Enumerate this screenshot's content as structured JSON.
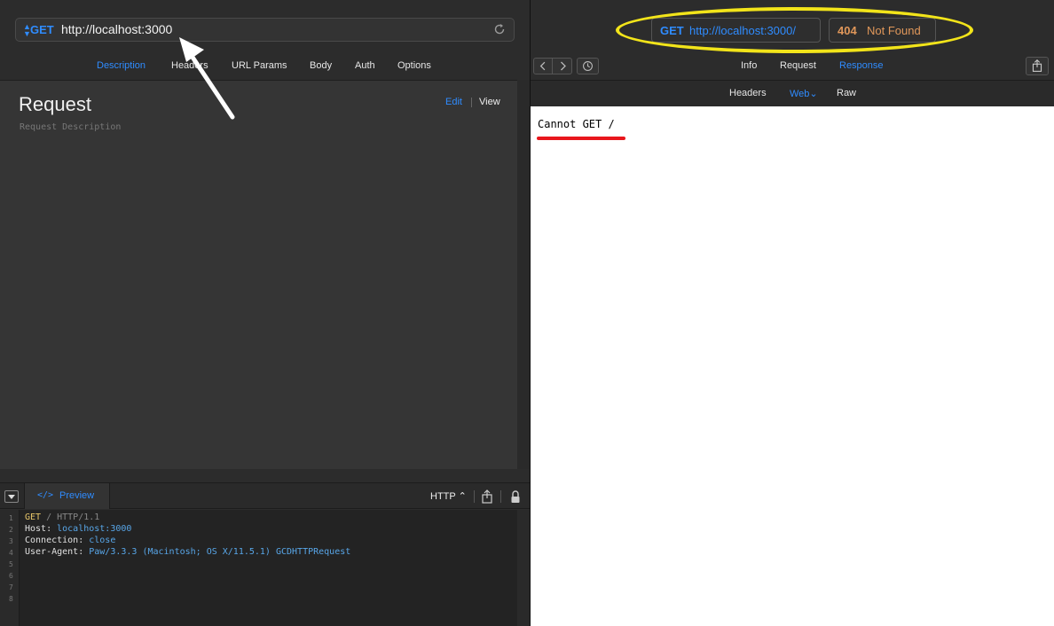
{
  "request": {
    "method": "GET",
    "url": "http://localhost:3000",
    "tabs": [
      "Description",
      "Headers",
      "URL Params",
      "Body",
      "Auth",
      "Options"
    ],
    "active_tab": "Description"
  },
  "description": {
    "title": "Request",
    "placeholder": "Request Description",
    "edit_label": "Edit",
    "view_label": "View"
  },
  "preview": {
    "tab_label": "Preview",
    "code_icon": "</>",
    "format_label": "HTTP ⌃",
    "line_numbers": [
      "1",
      "2",
      "3",
      "4",
      "5",
      "6",
      "7",
      "8"
    ],
    "lines": {
      "l1": {
        "method": "GET",
        "path": " / ",
        "version": "HTTP/1.1"
      },
      "l2": {
        "key": "Host: ",
        "value": "localhost:3000"
      },
      "l3": {
        "key": "Connection: ",
        "value": "close"
      },
      "l4": {
        "key": "User-Agent: ",
        "value": "Paw/3.3.3 (Macintosh; OS X/11.5.1) GCDHTTPRequest"
      }
    }
  },
  "response": {
    "method": "GET",
    "url": "http://localhost:3000/",
    "status_code": "404",
    "status_text": "Not Found",
    "tabs": [
      "Info",
      "Request",
      "Response"
    ],
    "active_tab": "Response",
    "sub_tabs": [
      "Headers",
      "Web",
      "Raw"
    ],
    "active_sub_tab": "Web",
    "web_dropdown": "Web⌄",
    "body_text": "Cannot GET /"
  },
  "colors": {
    "accent": "#2f8cff",
    "status": "#e0975a",
    "highlight_ellipse": "#f2e41a",
    "underline": "#e8161c"
  },
  "icons": [
    "reload-icon",
    "collapse-icon",
    "code-icon",
    "share-icon",
    "lock-icon",
    "chevron-left-icon",
    "chevron-right-icon",
    "history-icon",
    "annotation-arrow"
  ]
}
